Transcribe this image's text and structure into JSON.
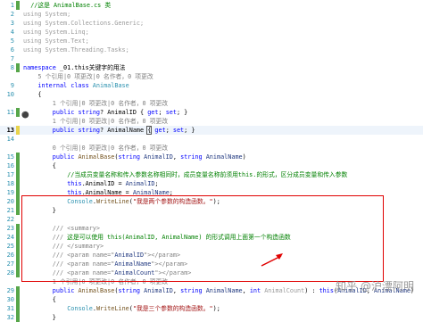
{
  "editor": {
    "lines": [
      {
        "num": "1",
        "change": "g",
        "current": false,
        "indent": 2,
        "tokens": [
          {
            "t": "//这是 AnimalBase.cs 类",
            "c": "comment"
          }
        ]
      },
      {
        "num": "2",
        "change": "",
        "current": false,
        "indent": 0,
        "tokens": [
          {
            "t": "using System;",
            "c": "faded"
          }
        ]
      },
      {
        "num": "3",
        "change": "",
        "current": false,
        "indent": 0,
        "tokens": [
          {
            "t": "using System.Collections.Generic;",
            "c": "faded"
          }
        ]
      },
      {
        "num": "4",
        "change": "",
        "current": false,
        "indent": 0,
        "tokens": [
          {
            "t": "using System.Linq;",
            "c": "faded"
          }
        ]
      },
      {
        "num": "5",
        "change": "",
        "current": false,
        "indent": 0,
        "tokens": [
          {
            "t": "using System.Text;",
            "c": "faded"
          }
        ]
      },
      {
        "num": "6",
        "change": "",
        "current": false,
        "indent": 0,
        "tokens": [
          {
            "t": "using System.Threading.Tasks;",
            "c": "faded"
          }
        ]
      },
      {
        "num": "7",
        "change": "",
        "current": false,
        "indent": 0,
        "tokens": []
      },
      {
        "num": "8",
        "change": "g",
        "current": false,
        "indent": 0,
        "tokens": [
          {
            "t": "namespace",
            "c": "keyword"
          },
          {
            "t": " _01.this关键字的用法",
            "c": "plain"
          }
        ]
      },
      {
        "num": "",
        "change": "",
        "current": false,
        "indent": 4,
        "tokens": [
          {
            "t": "5 个引用|0 项更改|0 名作者，0 项更改",
            "c": "meta"
          }
        ]
      },
      {
        "num": "9",
        "change": "",
        "current": false,
        "indent": 4,
        "tokens": [
          {
            "t": "internal",
            "c": "keyword"
          },
          {
            "t": " ",
            "c": "plain"
          },
          {
            "t": "class",
            "c": "keyword"
          },
          {
            "t": " ",
            "c": "plain"
          },
          {
            "t": "AnimalBase",
            "c": "type"
          }
        ]
      },
      {
        "num": "10",
        "change": "",
        "current": false,
        "indent": 4,
        "tokens": [
          {
            "t": "{",
            "c": "plain"
          }
        ]
      },
      {
        "num": "",
        "change": "",
        "current": false,
        "indent": 8,
        "tokens": [
          {
            "t": "1 个引用|0 项更改|0 名作者，0 项更改",
            "c": "meta"
          }
        ]
      },
      {
        "num": "11",
        "change": "g",
        "current": false,
        "indent": 8,
        "tokens": [
          {
            "t": "public",
            "c": "keyword"
          },
          {
            "t": " ",
            "c": "plain"
          },
          {
            "t": "string",
            "c": "keyword"
          },
          {
            "t": "? AnimalID { ",
            "c": "plain"
          },
          {
            "t": "get",
            "c": "keyword"
          },
          {
            "t": "; ",
            "c": "plain"
          },
          {
            "t": "set",
            "c": "keyword"
          },
          {
            "t": "; }",
            "c": "plain"
          }
        ]
      },
      {
        "num": "",
        "change": "",
        "current": false,
        "indent": 8,
        "tokens": [
          {
            "t": "1 个引用|0 项更改|0 名作者，0 项更改",
            "c": "meta"
          }
        ]
      },
      {
        "num": "13",
        "change": "y",
        "current": true,
        "indent": 8,
        "tokens": [
          {
            "t": "public",
            "c": "keyword"
          },
          {
            "t": " ",
            "c": "plain"
          },
          {
            "t": "string",
            "c": "keyword"
          },
          {
            "t": "? AnimalName ",
            "c": "plain"
          },
          {
            "t": "{",
            "c": "caret"
          },
          {
            "t": " ",
            "c": "plain"
          },
          {
            "t": "get",
            "c": "keyword"
          },
          {
            "t": "; ",
            "c": "plain"
          },
          {
            "t": "set",
            "c": "keyword"
          },
          {
            "t": "; }",
            "c": "plain"
          }
        ]
      },
      {
        "num": "14",
        "change": "",
        "current": false,
        "indent": 0,
        "tokens": []
      },
      {
        "num": "",
        "change": "",
        "current": false,
        "indent": 8,
        "tokens": [
          {
            "t": "0 个引用|0 项更改|0 名作者，0 项更改",
            "c": "meta"
          }
        ]
      },
      {
        "num": "15",
        "change": "g",
        "current": false,
        "indent": 8,
        "tokens": [
          {
            "t": "public",
            "c": "keyword"
          },
          {
            "t": " ",
            "c": "plain"
          },
          {
            "t": "AnimalBase",
            "c": "method"
          },
          {
            "t": "(",
            "c": "plain"
          },
          {
            "t": "string",
            "c": "keyword"
          },
          {
            "t": " ",
            "c": "plain"
          },
          {
            "t": "AnimalID",
            "c": "param"
          },
          {
            "t": ", ",
            "c": "plain"
          },
          {
            "t": "string",
            "c": "keyword"
          },
          {
            "t": " ",
            "c": "plain"
          },
          {
            "t": "AnimalName",
            "c": "param"
          },
          {
            "t": ")",
            "c": "plain"
          }
        ]
      },
      {
        "num": "16",
        "change": "g",
        "current": false,
        "indent": 8,
        "tokens": [
          {
            "t": "{",
            "c": "plain"
          }
        ]
      },
      {
        "num": "17",
        "change": "g",
        "current": false,
        "indent": 12,
        "tokens": [
          {
            "t": "//当成员变量名称和传入参数名称相同时，成员变量名称前须用this.的形式，区分成员变量和传入参数",
            "c": "comment"
          }
        ]
      },
      {
        "num": "18",
        "change": "g",
        "current": false,
        "indent": 12,
        "tokens": [
          {
            "t": "this",
            "c": "keyword"
          },
          {
            "t": ".AnimalID = ",
            "c": "plain"
          },
          {
            "t": "AnimalID",
            "c": "param"
          },
          {
            "t": ";",
            "c": "plain"
          }
        ]
      },
      {
        "num": "19",
        "change": "g",
        "current": false,
        "indent": 12,
        "tokens": [
          {
            "t": "this",
            "c": "keyword"
          },
          {
            "t": ".AnimalName = ",
            "c": "plain"
          },
          {
            "t": "AnimalName",
            "c": "param"
          },
          {
            "t": ";",
            "c": "plain"
          }
        ]
      },
      {
        "num": "20",
        "change": "g",
        "current": false,
        "indent": 12,
        "tokens": [
          {
            "t": "Console",
            "c": "type"
          },
          {
            "t": ".",
            "c": "plain"
          },
          {
            "t": "WriteLine",
            "c": "method"
          },
          {
            "t": "(",
            "c": "plain"
          },
          {
            "t": "\"我是两个参数的构造函数。\"",
            "c": "string"
          },
          {
            "t": ");",
            "c": "plain"
          }
        ]
      },
      {
        "num": "21",
        "change": "g",
        "current": false,
        "indent": 8,
        "tokens": [
          {
            "t": "}",
            "c": "plain"
          }
        ]
      },
      {
        "num": "22",
        "change": "",
        "current": false,
        "indent": 0,
        "tokens": []
      },
      {
        "num": "23",
        "change": "g",
        "current": false,
        "indent": 8,
        "tokens": [
          {
            "t": "/// <summary>",
            "c": "xmldoc"
          }
        ]
      },
      {
        "num": "24",
        "change": "g",
        "current": false,
        "indent": 8,
        "tokens": [
          {
            "t": "/// ",
            "c": "xmldoc"
          },
          {
            "t": "这是可以使用 this(AnimalID, AnimalName) 的形式调用上面第一个构造函数",
            "c": "comment"
          }
        ]
      },
      {
        "num": "25",
        "change": "g",
        "current": false,
        "indent": 8,
        "tokens": [
          {
            "t": "/// </summary>",
            "c": "xmldoc"
          }
        ]
      },
      {
        "num": "26",
        "change": "g",
        "current": false,
        "indent": 8,
        "tokens": [
          {
            "t": "/// <param name=\"",
            "c": "xmldoc"
          },
          {
            "t": "AnimalID",
            "c": "param"
          },
          {
            "t": "\"></param>",
            "c": "xmldoc"
          }
        ]
      },
      {
        "num": "27",
        "change": "g",
        "current": false,
        "indent": 8,
        "tokens": [
          {
            "t": "/// <param name=\"",
            "c": "xmldoc"
          },
          {
            "t": "AnimalName",
            "c": "param"
          },
          {
            "t": "\"></param>",
            "c": "xmldoc"
          }
        ]
      },
      {
        "num": "28",
        "change": "g",
        "current": false,
        "indent": 8,
        "tokens": [
          {
            "t": "/// <param name=\"",
            "c": "xmldoc"
          },
          {
            "t": "AnimalCount",
            "c": "param"
          },
          {
            "t": "\"></param>",
            "c": "xmldoc"
          }
        ]
      },
      {
        "num": "",
        "change": "",
        "current": false,
        "indent": 8,
        "tokens": [
          {
            "t": "1 个引用|0 项更改|0 名作者，0 项更改",
            "c": "meta"
          }
        ]
      },
      {
        "num": "29",
        "change": "g",
        "current": false,
        "indent": 8,
        "tokens": [
          {
            "t": "public",
            "c": "keyword"
          },
          {
            "t": " ",
            "c": "plain"
          },
          {
            "t": "AnimalBase",
            "c": "method"
          },
          {
            "t": "(",
            "c": "plain"
          },
          {
            "t": "string",
            "c": "keyword"
          },
          {
            "t": " ",
            "c": "plain"
          },
          {
            "t": "AnimalID",
            "c": "param"
          },
          {
            "t": ", ",
            "c": "plain"
          },
          {
            "t": "string",
            "c": "keyword"
          },
          {
            "t": " ",
            "c": "plain"
          },
          {
            "t": "AnimalName",
            "c": "param"
          },
          {
            "t": ", ",
            "c": "plain"
          },
          {
            "t": "int",
            "c": "keyword"
          },
          {
            "t": " ",
            "c": "plain"
          },
          {
            "t": "AnimalCount",
            "c": "faded"
          },
          {
            "t": ") : ",
            "c": "plain"
          },
          {
            "t": "this",
            "c": "keyword"
          },
          {
            "t": "(",
            "c": "plain"
          },
          {
            "t": "AnimalID",
            "c": "param"
          },
          {
            "t": ", ",
            "c": "plain"
          },
          {
            "t": "AnimalName",
            "c": "param"
          },
          {
            "t": ")",
            "c": "plain"
          }
        ]
      },
      {
        "num": "30",
        "change": "g",
        "current": false,
        "indent": 8,
        "tokens": [
          {
            "t": "{",
            "c": "plain"
          }
        ]
      },
      {
        "num": "31",
        "change": "g",
        "current": false,
        "indent": 12,
        "tokens": [
          {
            "t": "Console",
            "c": "type"
          },
          {
            "t": ".",
            "c": "plain"
          },
          {
            "t": "WriteLine",
            "c": "method"
          },
          {
            "t": "(",
            "c": "plain"
          },
          {
            "t": "\"我是三个参数的构造函数。\"",
            "c": "string"
          },
          {
            "t": ");",
            "c": "plain"
          }
        ]
      },
      {
        "num": "32",
        "change": "g",
        "current": false,
        "indent": 8,
        "tokens": [
          {
            "t": "}",
            "c": "plain"
          }
        ]
      }
    ]
  },
  "watermark": "知乎 @沪漂阿明",
  "lightbulb_icon": "lightbulb-icon",
  "colors": {
    "keyword": "#0000ff",
    "type": "#2b91af",
    "string": "#a31515",
    "comment": "#008000",
    "highlight_box": "#e00000"
  }
}
